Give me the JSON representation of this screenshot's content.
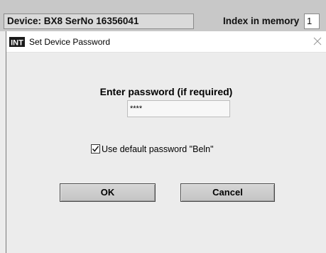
{
  "app": {
    "device_label": "Device: BX8 SerNo 16356041",
    "index_label": "Index in memory",
    "index_value": "1"
  },
  "dialog": {
    "title": "Set Device Password",
    "logo_text": "INT",
    "heading": "Enter password (if required)",
    "password_value": "****",
    "checkbox_label": "Use default password \"Beln\"",
    "checkbox_checked": true,
    "ok_label": "OK",
    "cancel_label": "Cancel"
  }
}
